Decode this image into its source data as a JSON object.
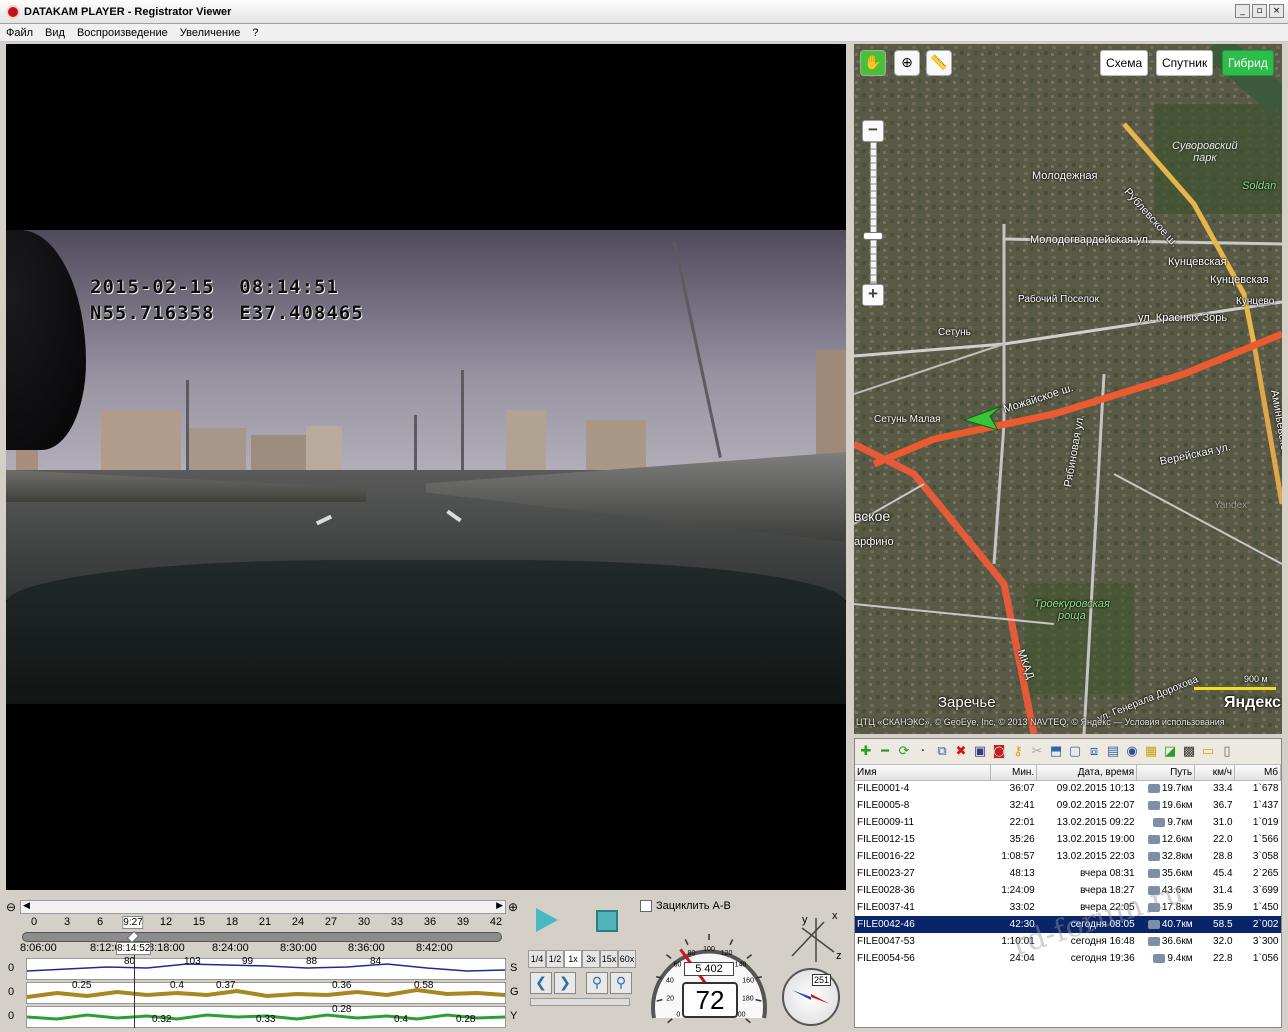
{
  "window": {
    "title": "DATAKAM PLAYER - Registrator Viewer",
    "controls": [
      "_",
      "▫",
      "×"
    ]
  },
  "menu": [
    "Файл",
    "Вид",
    "Воспроизведение",
    "Увеличение",
    "?"
  ],
  "video": {
    "osd_datetime": "2015-02-15  08:14:51",
    "osd_coords": "N55.716358  E37.408465"
  },
  "map": {
    "layers": [
      "Схема",
      "Спутник",
      "Гибрид"
    ],
    "active_layer": "Гибрид",
    "labels": {
      "suvorovsky": "Суворовский\nпарк",
      "molodezhnaya": "Молодежная",
      "rublevskoe": "Рублевское ш.",
      "soldat": "Soldan",
      "molodogvard": "Молодогвардейская ул.",
      "kuntsevskaya1": "Кунцевская",
      "kuntsevskaya2": "Кунцевская",
      "rabochiy": "Рабочий Поселок",
      "kuntsevo": "Кунцево",
      "setun": "Сетунь",
      "krasnykh_zor": "ул. Красных Зорь",
      "mozhayskoe": "Можайское ш.",
      "setun_malaya": "Сетунь Малая",
      "aminevskoe": "Аминьевское",
      "vereyskaya": "Верейская ул.",
      "skoe": "вское",
      "parfino": "арфино",
      "ryabinovaya": "Рябиновая ул.",
      "troekurovskaya": "Троекуровская\nроща",
      "mkad": "МКАД",
      "zarechye": "Заречье",
      "generala_dorokhova": "ул. Генерала Дорохова",
      "scale": "900 м",
      "yandex": "Яндекс",
      "copyright": "ЦТЦ «СКАНЭКС», © GeoEye, Inc, © 2013 NAVTEQ, © Яндекс — Условия использования",
      "yandex_wm": "Yandex"
    }
  },
  "file_table": {
    "headers": [
      "Имя",
      "Мин.",
      "Дата, время",
      "Путь",
      "км/ч",
      "Мб"
    ],
    "rows": [
      {
        "name": "FILE0001-4",
        "min": "36:07",
        "date": "09.02.2015 10:13",
        "path": "19.7км",
        "kmh": "33.4",
        "mb": "1`678"
      },
      {
        "name": "FILE0005-8",
        "min": "32:41",
        "date": "09.02.2015 22:07",
        "path": "19.6км",
        "kmh": "36.7",
        "mb": "1`437"
      },
      {
        "name": "FILE0009-11",
        "min": "22:01",
        "date": "13.02.2015 09:22",
        "path": "9.7км",
        "kmh": "31.0",
        "mb": "1`019"
      },
      {
        "name": "FILE0012-15",
        "min": "35:26",
        "date": "13.02.2015 19:00",
        "path": "12.6км",
        "kmh": "22.0",
        "mb": "1`566"
      },
      {
        "name": "FILE0016-22",
        "min": "1:08:57",
        "date": "13.02.2015 22:03",
        "path": "32.8км",
        "kmh": "28.8",
        "mb": "3`058"
      },
      {
        "name": "FILE0023-27",
        "min": "48:13",
        "date": "вчера 08:31",
        "path": "35.6км",
        "kmh": "45.4",
        "mb": "2`265"
      },
      {
        "name": "FILE0028-36",
        "min": "1:24:09",
        "date": "вчера 18:27",
        "path": "43.6км",
        "kmh": "31.4",
        "mb": "3`699"
      },
      {
        "name": "FILE0037-41",
        "min": "33:02",
        "date": "вчера 22:05",
        "path": "17.8км",
        "kmh": "35.9",
        "mb": "1`450"
      },
      {
        "name": "FILE0042-46",
        "min": "42:30",
        "date": "сегодня 08:05",
        "path": "40.7км",
        "kmh": "58.5",
        "mb": "2`002",
        "selected": true
      },
      {
        "name": "FILE0047-53",
        "min": "1:10:01",
        "date": "сегодня 16:48",
        "path": "36.6км",
        "kmh": "32.0",
        "mb": "3`300"
      },
      {
        "name": "FILE0054-56",
        "min": "24:04",
        "date": "сегодня 19:36",
        "path": "9.4км",
        "kmh": "22.8",
        "mb": "1`056"
      }
    ]
  },
  "watermark": "rd-forum.ru",
  "timeline": {
    "minute_ticks": [
      "0",
      "3",
      "6",
      "9:27",
      "12",
      "15",
      "18",
      "21",
      "24",
      "27",
      "30",
      "33",
      "36",
      "39",
      "42"
    ],
    "time_ticks": [
      "8:06:00",
      "8:12:0",
      "8:14:52",
      "8:18:00",
      "8:24:00",
      "8:30:00",
      "8:36:00",
      "8:42:00"
    ],
    "position_fraction": 0.222
  },
  "graphs": {
    "S": {
      "zero": "0",
      "tag": "S",
      "values": [
        "80",
        "103",
        "99",
        "88",
        "84"
      ]
    },
    "G": {
      "zero": "0",
      "tag": "G",
      "values": [
        "0.25",
        "0.4",
        "0.37",
        "0.36",
        "0.58"
      ]
    },
    "Y": {
      "zero": "0",
      "tag": "Y",
      "values": [
        "0.32",
        "0.33",
        "0.28",
        "0.4",
        "0.28"
      ]
    }
  },
  "playback": {
    "speeds": [
      "1/4",
      "1/2",
      "1x",
      "3x",
      "15x",
      "60x"
    ],
    "active_speed": "1x",
    "loop_label": "Зациклить A-B"
  },
  "speedometer": {
    "speed": "72",
    "odometer": "5 402",
    "scale": [
      "0",
      "20",
      "40",
      "60",
      "80",
      "100",
      "120",
      "140",
      "160",
      "180",
      "200"
    ]
  },
  "compass": {
    "heading": "251"
  },
  "axes": {
    "x": "x",
    "y": "y",
    "z": "z"
  }
}
